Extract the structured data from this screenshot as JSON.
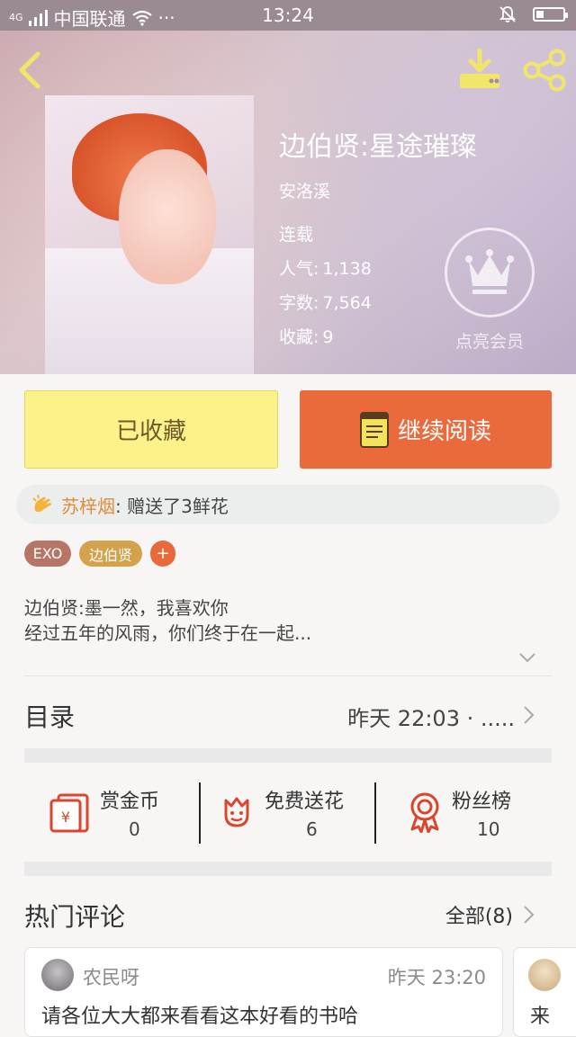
{
  "status_bar": {
    "signal": "4G",
    "carrier": "中国联通",
    "more": "···",
    "time": "13:24"
  },
  "book": {
    "title": "边伯贤:星途璀璨",
    "author": "安洛溪",
    "status": "连载",
    "popularity_label": "人气:",
    "popularity": "1,138",
    "word_count_label": "字数:",
    "word_count": "7,564",
    "favorites_label": "收藏:",
    "favorites": "9"
  },
  "vip": {
    "label": "点亮会员"
  },
  "actions": {
    "collected_label": "已收藏",
    "continue_label": "继续阅读"
  },
  "gift": {
    "user": "苏梓烟",
    "text": ": 赠送了3鲜花"
  },
  "tags": [
    "EXO",
    "边伯贤",
    "+"
  ],
  "intro": {
    "line1": "边伯贤:墨一然，我喜欢你",
    "line2": "经过五年的风雨，你们终于在一起..."
  },
  "toc": {
    "title": "目录",
    "latest": "昨天 22:03 · ....."
  },
  "stats": [
    {
      "name": "赏金币",
      "value": "0",
      "icon": "red-envelope-icon"
    },
    {
      "name": "免费送花",
      "value": "6",
      "icon": "flower-icon"
    },
    {
      "name": "粉丝榜",
      "value": "10",
      "icon": "medal-icon"
    }
  ],
  "comments": {
    "title": "热门评论",
    "all_label": "全部(8)",
    "items": [
      {
        "user": "农民呀",
        "time": "昨天 23:20",
        "text": "请各位大大都来看看这本好看的书哈"
      },
      {
        "text": "来"
      }
    ]
  },
  "colors": {
    "accent_orange": "#ea6a3c",
    "collected_yellow": "#fdf28a",
    "icon_yellow": "#f4e25a",
    "stat_icon_red": "#d9452f"
  }
}
